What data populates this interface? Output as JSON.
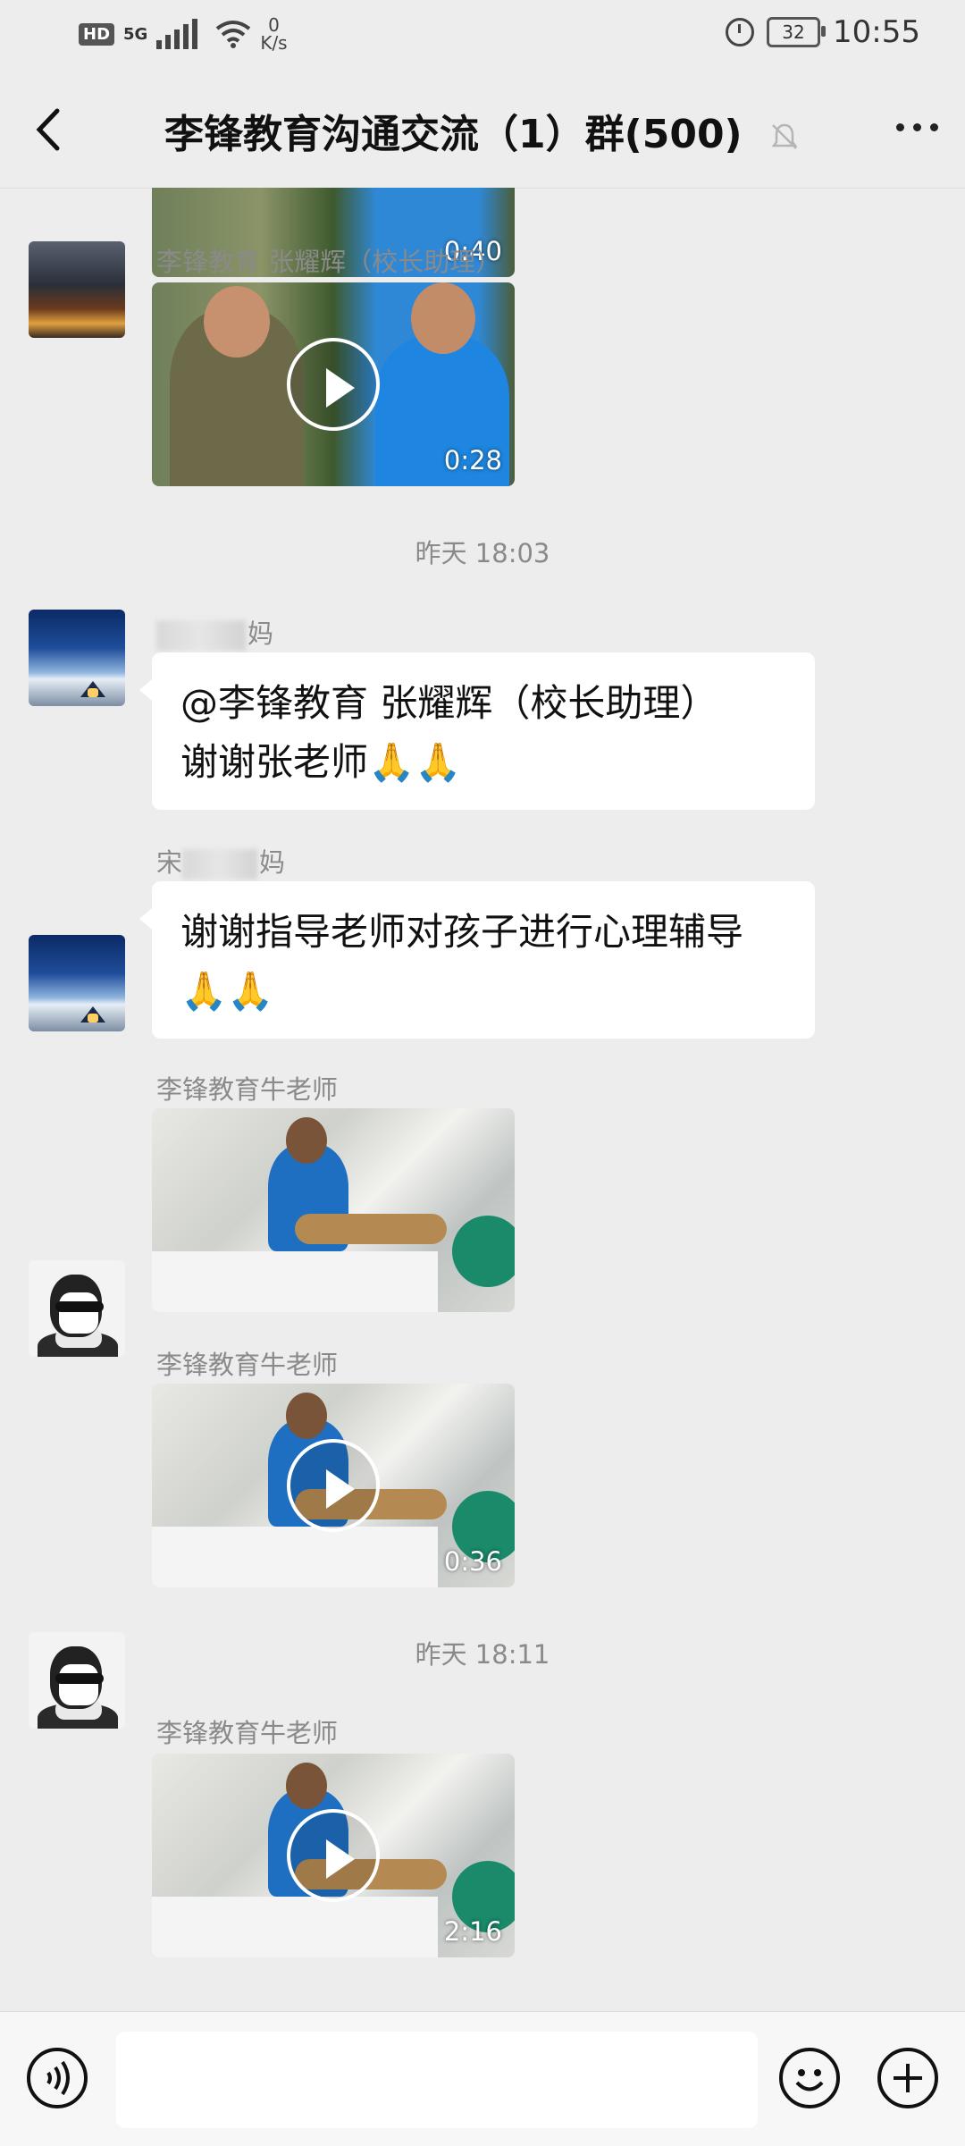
{
  "status_bar": {
    "hd": "HD",
    "network_type": "5G",
    "speed_value": "0",
    "speed_unit": "K/s",
    "battery": "32",
    "time": "10:55"
  },
  "header": {
    "title": "李锋教育沟通交流（1）群(500)",
    "back_icon": "chevron-left-icon",
    "mute_icon": "bell-off-icon",
    "more_icon": "more-dots-icon"
  },
  "partial_top": {
    "duration": "0:40"
  },
  "messages": [
    {
      "sender": "李锋教育  张耀辉（校长助理）",
      "type": "video",
      "duration": "0:28"
    },
    {
      "time": "昨天 18:03"
    },
    {
      "sender_suffix": "妈",
      "type": "text",
      "text_line1": "@李锋教育  张耀辉（校长助理）",
      "text_line2": "谢谢张老师",
      "emoji": "🙏🙏"
    },
    {
      "sender": "宋",
      "sender_suffix": "妈",
      "type": "text",
      "text_line1": "谢谢指导老师对孩子进行心理辅导",
      "emoji": "🙏🙏"
    },
    {
      "sender": "李锋教育牛老师",
      "type": "image"
    },
    {
      "sender": "李锋教育牛老师",
      "type": "video",
      "duration": "0:36"
    },
    {
      "time": "昨天 18:11"
    },
    {
      "sender": "李锋教育牛老师",
      "type": "video",
      "duration": "2:16"
    }
  ],
  "input_bar": {
    "voice_icon": "voice-icon",
    "emoji_icon": "smile-icon",
    "plus_icon": "plus-icon"
  }
}
